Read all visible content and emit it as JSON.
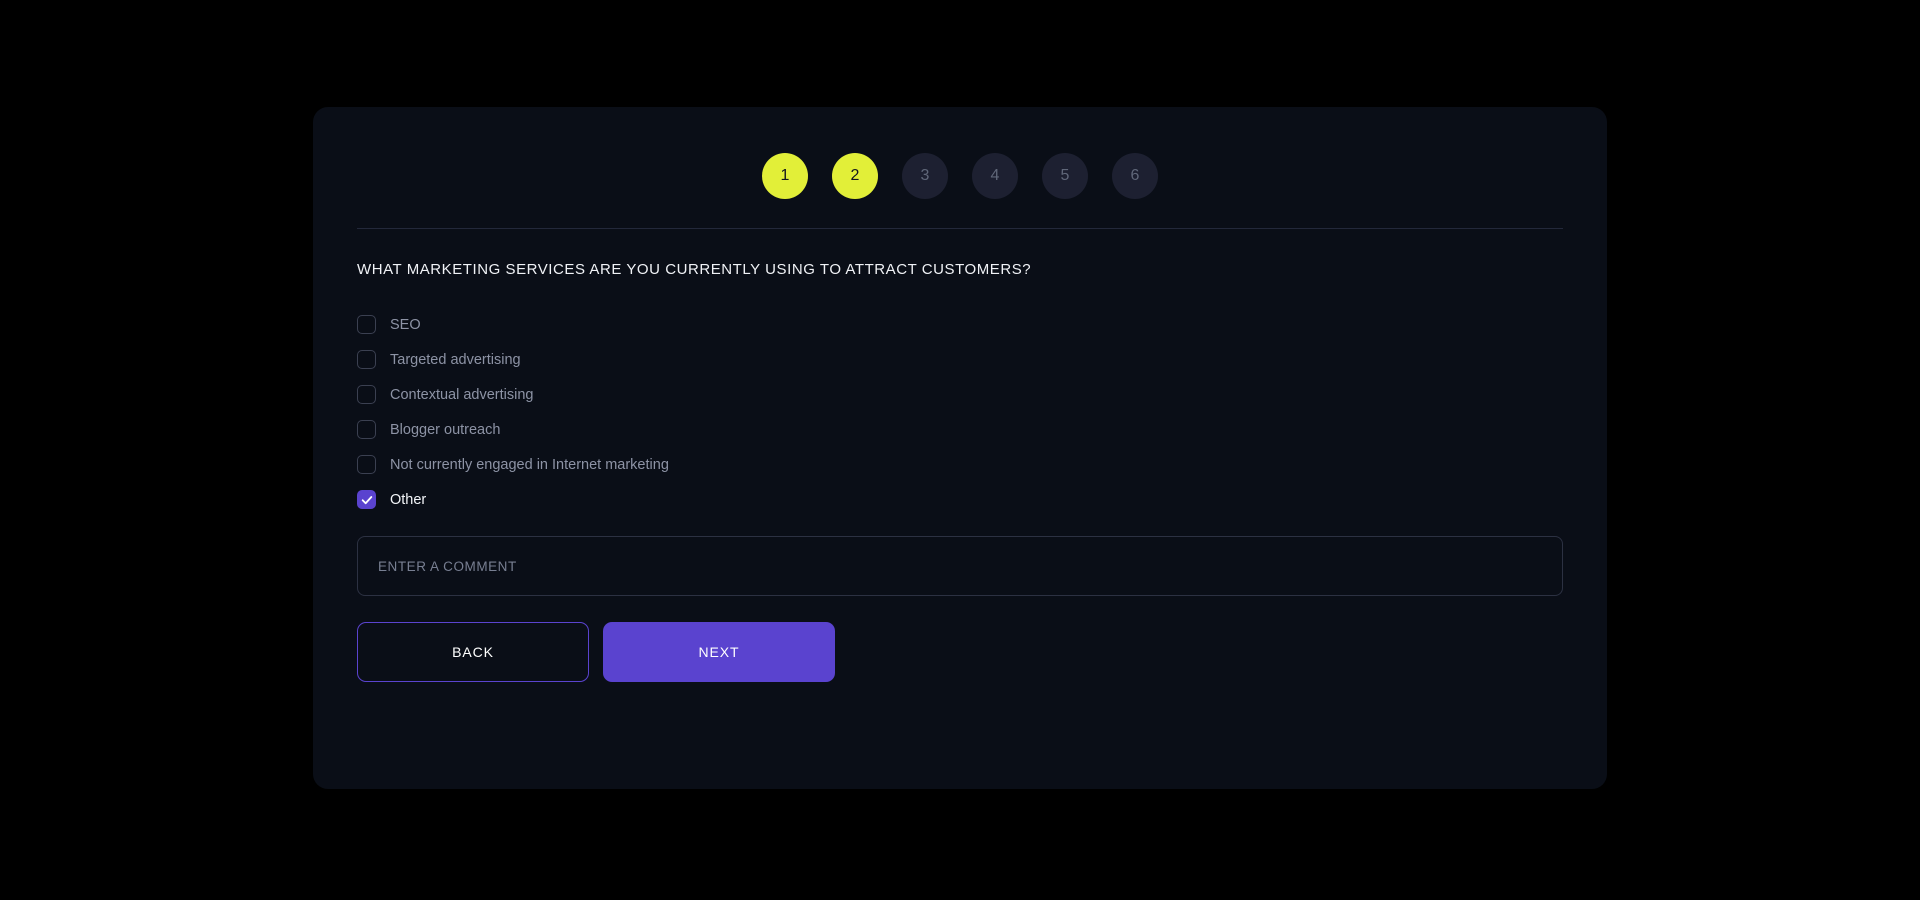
{
  "colors": {
    "page_background": "#000000",
    "card_background": "#0a0e17",
    "accent_yellow": "#e2ef38",
    "accent_purple": "#5a43cf",
    "inactive_step": "#1d2031",
    "muted_text": "#8d93a5"
  },
  "stepper": {
    "steps": [
      {
        "number": "1",
        "state": "active"
      },
      {
        "number": "2",
        "state": "active"
      },
      {
        "number": "3",
        "state": "inactive"
      },
      {
        "number": "4",
        "state": "inactive"
      },
      {
        "number": "5",
        "state": "inactive"
      },
      {
        "number": "6",
        "state": "inactive"
      }
    ]
  },
  "form": {
    "question": "WHAT MARKETING SERVICES ARE YOU CURRENTLY USING TO ATTRACT CUSTOMERS?",
    "options": [
      {
        "label": "SEO",
        "checked": false
      },
      {
        "label": "Targeted advertising",
        "checked": false
      },
      {
        "label": "Contextual advertising",
        "checked": false
      },
      {
        "label": "Blogger outreach",
        "checked": false
      },
      {
        "label": "Not currently engaged in Internet marketing",
        "checked": false
      },
      {
        "label": "Other",
        "checked": true
      }
    ],
    "comment": {
      "value": "",
      "placeholder": "ENTER A COMMENT"
    }
  },
  "actions": {
    "back_label": "BACK",
    "next_label": "NEXT"
  }
}
